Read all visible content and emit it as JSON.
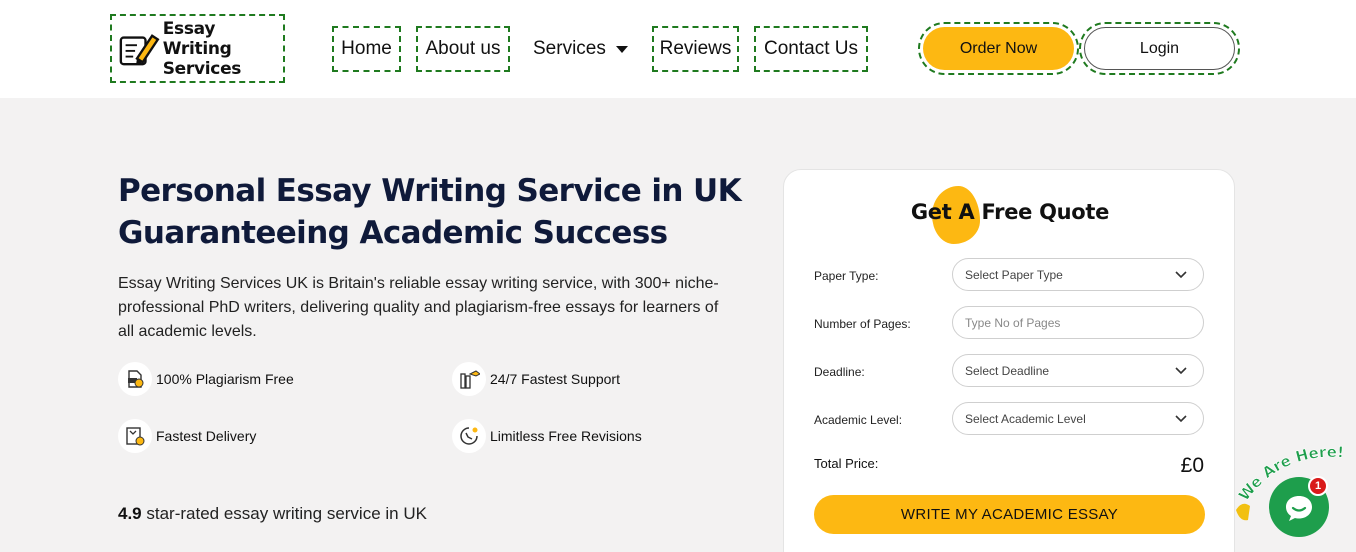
{
  "header": {
    "logo_line1": "Essay Writing",
    "logo_line2": "Services",
    "nav": {
      "home": "Home",
      "about": "About us",
      "services": "Services",
      "reviews": "Reviews",
      "contact": "Contact Us"
    },
    "order_now": "Order Now",
    "login": "Login"
  },
  "hero": {
    "title_line1": "Personal Essay Writing Service in UK",
    "title_line2": "Guaranteeing Academic Success",
    "description": "Essay Writing Services UK is Britain's reliable essay writing service, with 300+ niche-professional PhD writers, delivering quality and plagiarism-free essays for learners of all academic levels.",
    "features": {
      "plagiarism": "100% Plagiarism Free",
      "support": "24/7 Fastest Support",
      "delivery": "Fastest Delivery",
      "revisions": "Limitless Free Revisions"
    },
    "rating_value": "4.9",
    "rating_text": " star-rated essay writing service in UK"
  },
  "quote": {
    "title": "Get A Free Quote",
    "paper_type_label": "Paper Type:",
    "paper_type_value": "Select Paper Type",
    "pages_label": "Number of Pages:",
    "pages_placeholder": "Type No of Pages",
    "deadline_label": "Deadline:",
    "deadline_value": "Select Deadline",
    "level_label": "Academic Level:",
    "level_value": "Select Academic Level",
    "total_label": "Total Price:",
    "total_value": "£0",
    "submit": "WRITE MY ACADEMIC ESSAY"
  },
  "chat": {
    "banner": "We Are Here!",
    "badge_count": "1"
  },
  "colors": {
    "accent": "#fdb812",
    "chat_green": "#1e9e4c",
    "title_navy": "#0f1a3a"
  }
}
